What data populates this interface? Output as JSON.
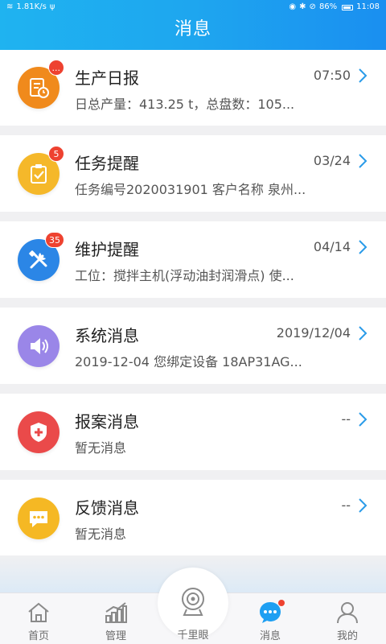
{
  "status_bar": {
    "net_speed": "1.81K/s",
    "battery": "86%",
    "time": "11:08"
  },
  "header": {
    "title": "消息"
  },
  "messages": [
    {
      "title": "生产日报",
      "time": "07:50",
      "preview": "日总产量：413.25 t，总盘数：105...",
      "badge": "...",
      "icon": "daily-report-icon",
      "color": "#f08a1c"
    },
    {
      "title": "任务提醒",
      "time": "03/24",
      "preview": "任务编号2020031901 客户名称 泉州...",
      "badge": "5",
      "icon": "task-clipboard-icon",
      "color": "#f5b82a"
    },
    {
      "title": "维护提醒",
      "time": "04/14",
      "preview": "工位：搅拌主机(浮动油封润滑点) 使...",
      "badge": "35",
      "icon": "maintenance-tools-icon",
      "color": "#2b86e6"
    },
    {
      "title": "系统消息",
      "time": "2019/12/04",
      "preview": "2019-12-04  您绑定设备 18AP31AG...",
      "badge": "",
      "icon": "speaker-icon",
      "color": "#9a86e8"
    },
    {
      "title": "报案消息",
      "time": "--",
      "preview": "暂无消息",
      "badge": "",
      "icon": "shield-plus-icon",
      "color": "#ea4a4a"
    },
    {
      "title": "反馈消息",
      "time": "--",
      "preview": "暂无消息",
      "badge": "",
      "icon": "chat-bubble-icon",
      "color": "#f5b824"
    }
  ],
  "tabbar": {
    "tabs": [
      {
        "label": "首页",
        "icon": "home-icon"
      },
      {
        "label": "管理",
        "icon": "chart-icon"
      },
      {
        "label": "千里眼",
        "icon": "camera-icon"
      },
      {
        "label": "消息",
        "icon": "message-icon",
        "active": true
      },
      {
        "label": "我的",
        "icon": "user-icon"
      }
    ]
  },
  "colors": {
    "accent": "#1e9ff2",
    "badge": "#ee4230"
  }
}
